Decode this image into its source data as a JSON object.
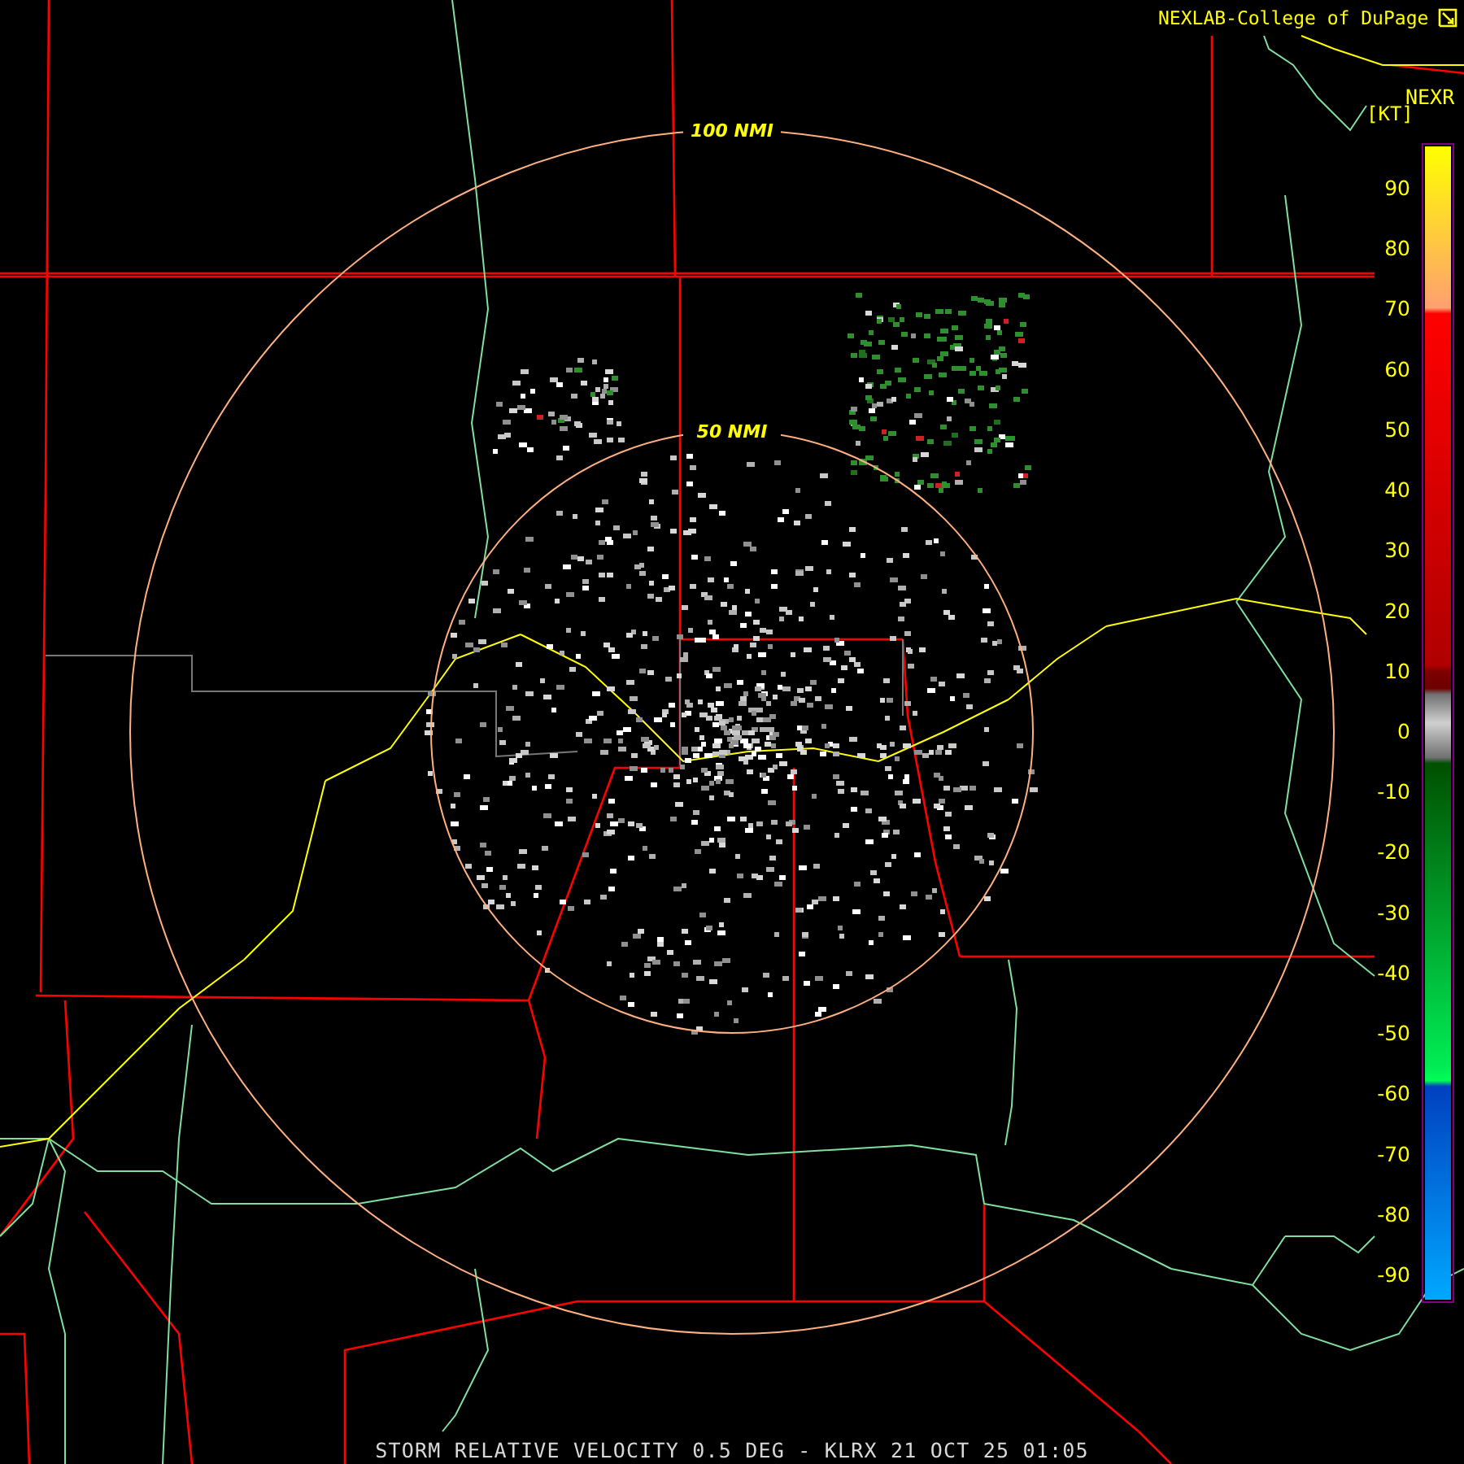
{
  "credit": {
    "text": "NEXLAB-College of DuPage"
  },
  "product_code": "NEXR",
  "legend": {
    "unit": "[KT]",
    "ticks": [
      "90",
      "80",
      "70",
      "60",
      "50",
      "40",
      "30",
      "20",
      "10",
      "0",
      "-10",
      "-20",
      "-30",
      "-40",
      "-50",
      "-60",
      "-70",
      "-80",
      "-90"
    ]
  },
  "range_rings": [
    {
      "label": "100 NMI"
    },
    {
      "label": "50 NMI"
    }
  ],
  "caption": "STORM RELATIVE VELOCITY 0.5 DEG - KLRX 21 OCT 25 01:05"
}
